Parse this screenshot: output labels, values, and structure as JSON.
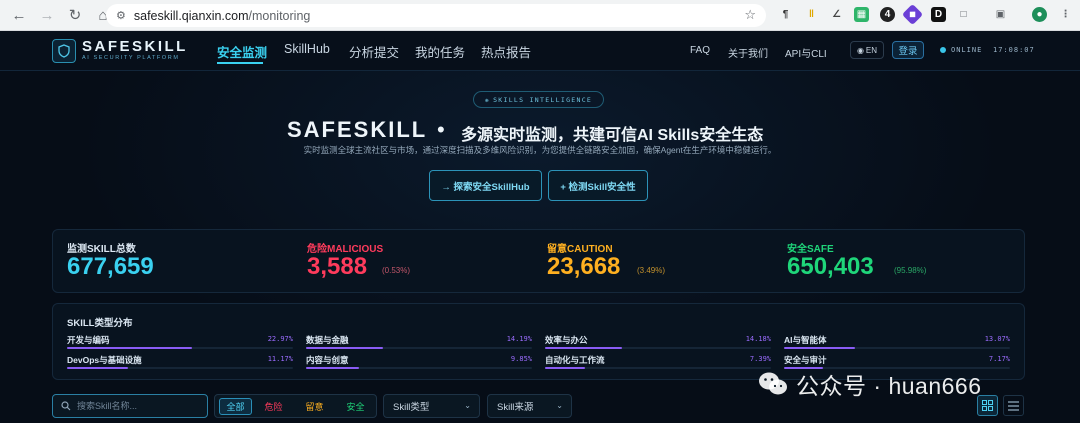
{
  "browser": {
    "url_host": "safeskill.qianxin.com",
    "url_path": "/monitoring"
  },
  "brand": {
    "name": "SAFESKILL",
    "subtitle": "AI SECURITY PLATFORM"
  },
  "nav": {
    "items": [
      {
        "label": "安全监测",
        "active": true
      },
      {
        "label": "SkillHub"
      },
      {
        "label": "分析提交"
      },
      {
        "label": "我的任务"
      },
      {
        "label": "热点报告"
      }
    ],
    "faq": "FAQ",
    "about": "关于我们",
    "api": "API与CLI",
    "lang": "EN",
    "login": "登录",
    "status": "ONLINE",
    "clock": "17:08:07"
  },
  "hero": {
    "pill": "SKILLS INTELLIGENCE",
    "brand": "SAFESKILL",
    "dot": "•",
    "tagline": "多源实时监测，共建可信AI Skills安全生态",
    "description": "实时监测全球主流社区与市场，通过深度扫描及多维风险识别，为您提供全链路安全加固，确保Agent在生产环境中稳健运行。",
    "cta_explore": "→ 探索安全SkillHub",
    "cta_detect": "+ 检测Skill安全性"
  },
  "stats": [
    {
      "label": "监测SKILL总数",
      "value": "677,659",
      "pct": "",
      "color": "#3ad1f0"
    },
    {
      "label": "危险MALICIOUS",
      "value": "3,588",
      "pct": "(0.53%)",
      "color": "#ff3b5c"
    },
    {
      "label": "留意CAUTION",
      "value": "23,668",
      "pct": "(3.49%)",
      "color": "#ffb020"
    },
    {
      "label": "安全SAFE",
      "value": "650,403",
      "pct": "(95.98%)",
      "color": "#1fd67a"
    }
  ],
  "types": {
    "title": "SKILL类型分布",
    "items": [
      {
        "name": "开发与编码",
        "pct": "22.97%",
        "ratio": 0.2297
      },
      {
        "name": "数据与金融",
        "pct": "14.19%",
        "ratio": 0.1419
      },
      {
        "name": "效率与办公",
        "pct": "14.18%",
        "ratio": 0.1418
      },
      {
        "name": "AI与智能体",
        "pct": "13.07%",
        "ratio": 0.1307
      },
      {
        "name": "DevOps与基础设施",
        "pct": "11.17%",
        "ratio": 0.1117
      },
      {
        "name": "内容与创意",
        "pct": "9.85%",
        "ratio": 0.0985
      },
      {
        "name": "自动化与工作流",
        "pct": "7.39%",
        "ratio": 0.0739
      },
      {
        "name": "安全与审计",
        "pct": "7.17%",
        "ratio": 0.0717
      }
    ]
  },
  "filters": {
    "search_placeholder": "搜索Skill名称...",
    "all": "全部",
    "danger": "危险",
    "caution": "留意",
    "safe": "安全",
    "type_select": "Skill类型",
    "source_select": "Skill来源"
  },
  "watermark": {
    "text": "公众号 · huan666"
  },
  "colors": {
    "accent": "#3ad1f0",
    "danger": "#ff3b5c",
    "caution": "#ffb020",
    "safe": "#1fd67a",
    "bar": "#8a5cf5"
  }
}
